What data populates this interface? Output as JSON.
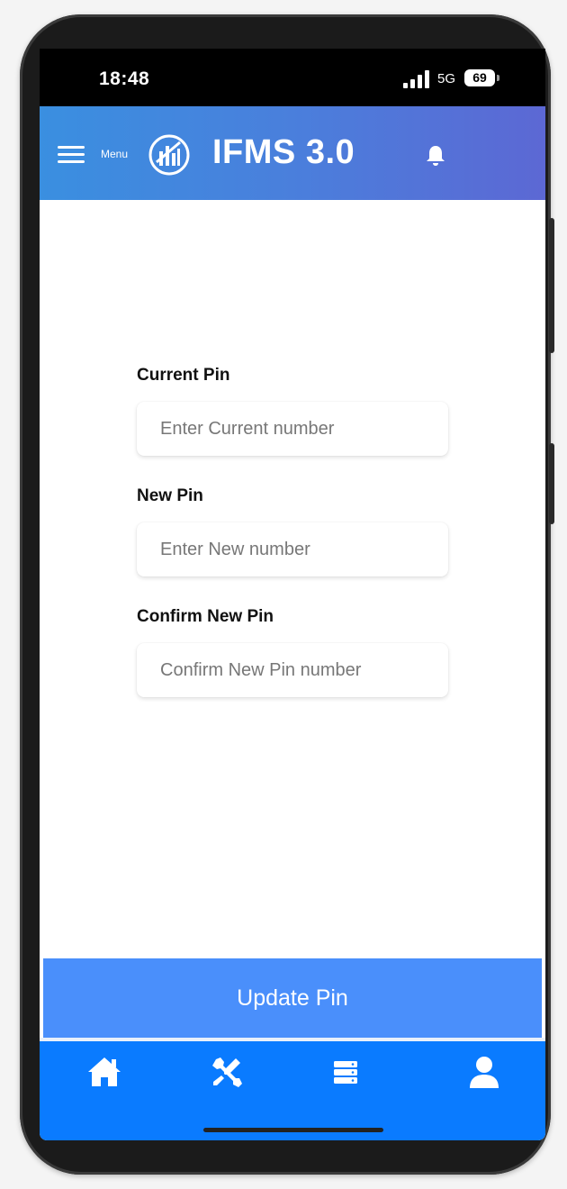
{
  "status_bar": {
    "time": "18:48",
    "network": "5G",
    "battery": "69"
  },
  "app_bar": {
    "menu_label": "Menu",
    "title": "IFMS 3.0",
    "gradient_start": "#3a8fe0",
    "gradient_end": "#5c68d4"
  },
  "form": {
    "current_pin": {
      "label": "Current Pin",
      "placeholder": "Enter Current number",
      "value": ""
    },
    "new_pin": {
      "label": "New Pin",
      "placeholder": "Enter New number",
      "value": ""
    },
    "confirm_pin": {
      "label": "Confirm New Pin",
      "placeholder": "Confirm New Pin number",
      "value": ""
    }
  },
  "actions": {
    "update_label": "Update Pin",
    "button_color": "#4a8ffb"
  },
  "bottom_nav": {
    "color": "#0a7bff",
    "items": [
      {
        "icon": "home-icon"
      },
      {
        "icon": "tools-icon"
      },
      {
        "icon": "server-icon"
      },
      {
        "icon": "user-icon"
      }
    ]
  }
}
